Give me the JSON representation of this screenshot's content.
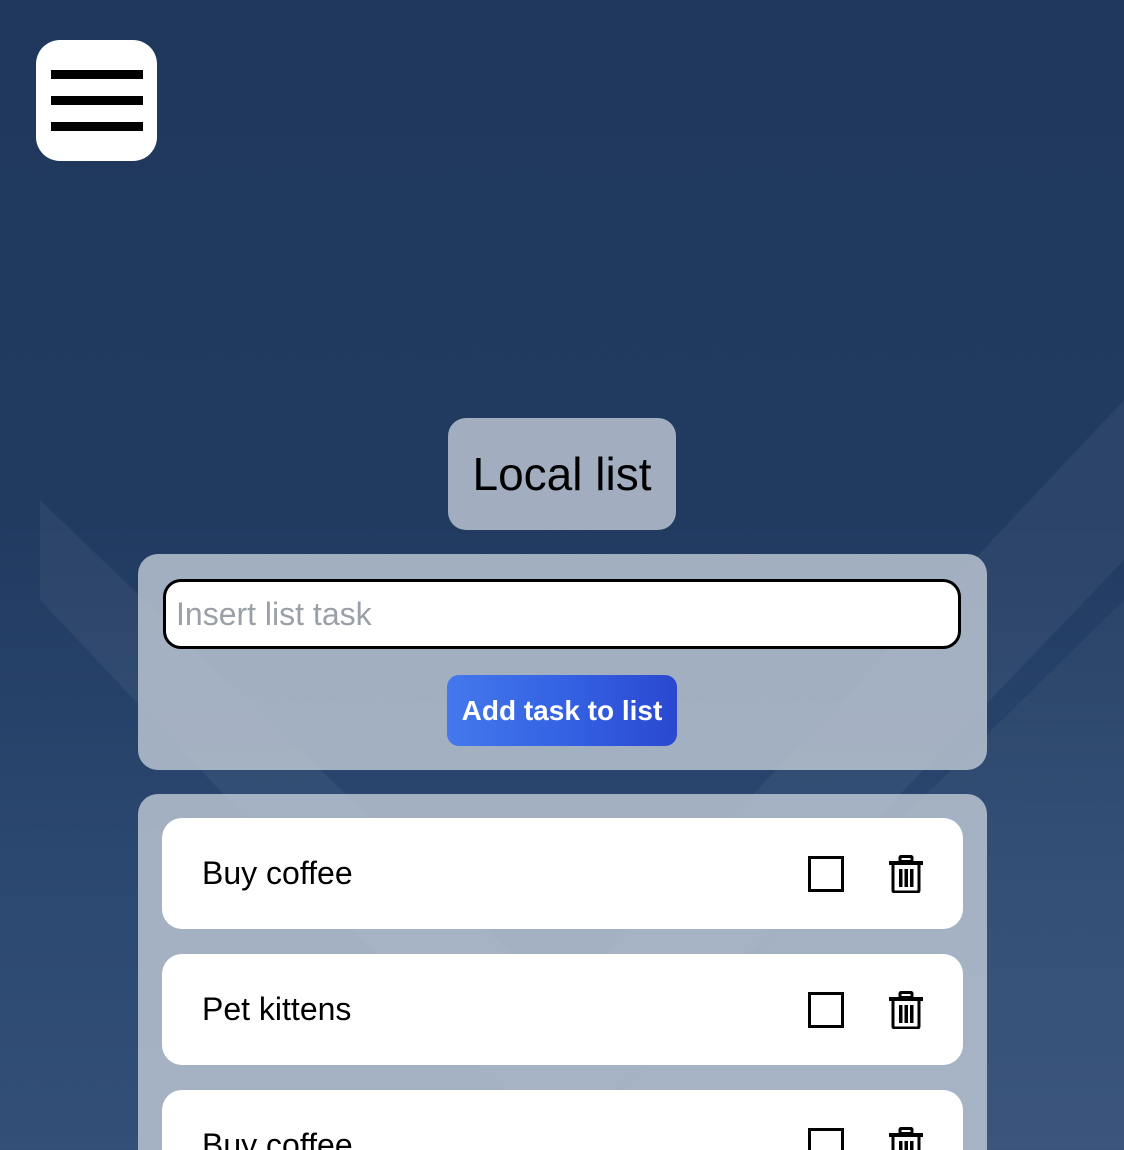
{
  "header": {
    "menu_icon": "hamburger-menu-icon"
  },
  "list": {
    "title": "Local list"
  },
  "form": {
    "input_value": "",
    "input_placeholder": "Insert list task",
    "add_button_label": "Add task to list"
  },
  "tasks": [
    {
      "label": "Buy coffee",
      "checked": false,
      "check_icon": "checkbox-icon",
      "delete_icon": "trash-icon"
    },
    {
      "label": "Pet kittens",
      "checked": false,
      "check_icon": "checkbox-icon",
      "delete_icon": "trash-icon"
    },
    {
      "label": "Buy coffee",
      "checked": false,
      "check_icon": "checkbox-icon",
      "delete_icon": "trash-icon"
    }
  ],
  "colors": {
    "background": "#213a60",
    "panel": "#bec8d4",
    "button_start": "#4478ec",
    "button_end": "#2a48d0"
  }
}
